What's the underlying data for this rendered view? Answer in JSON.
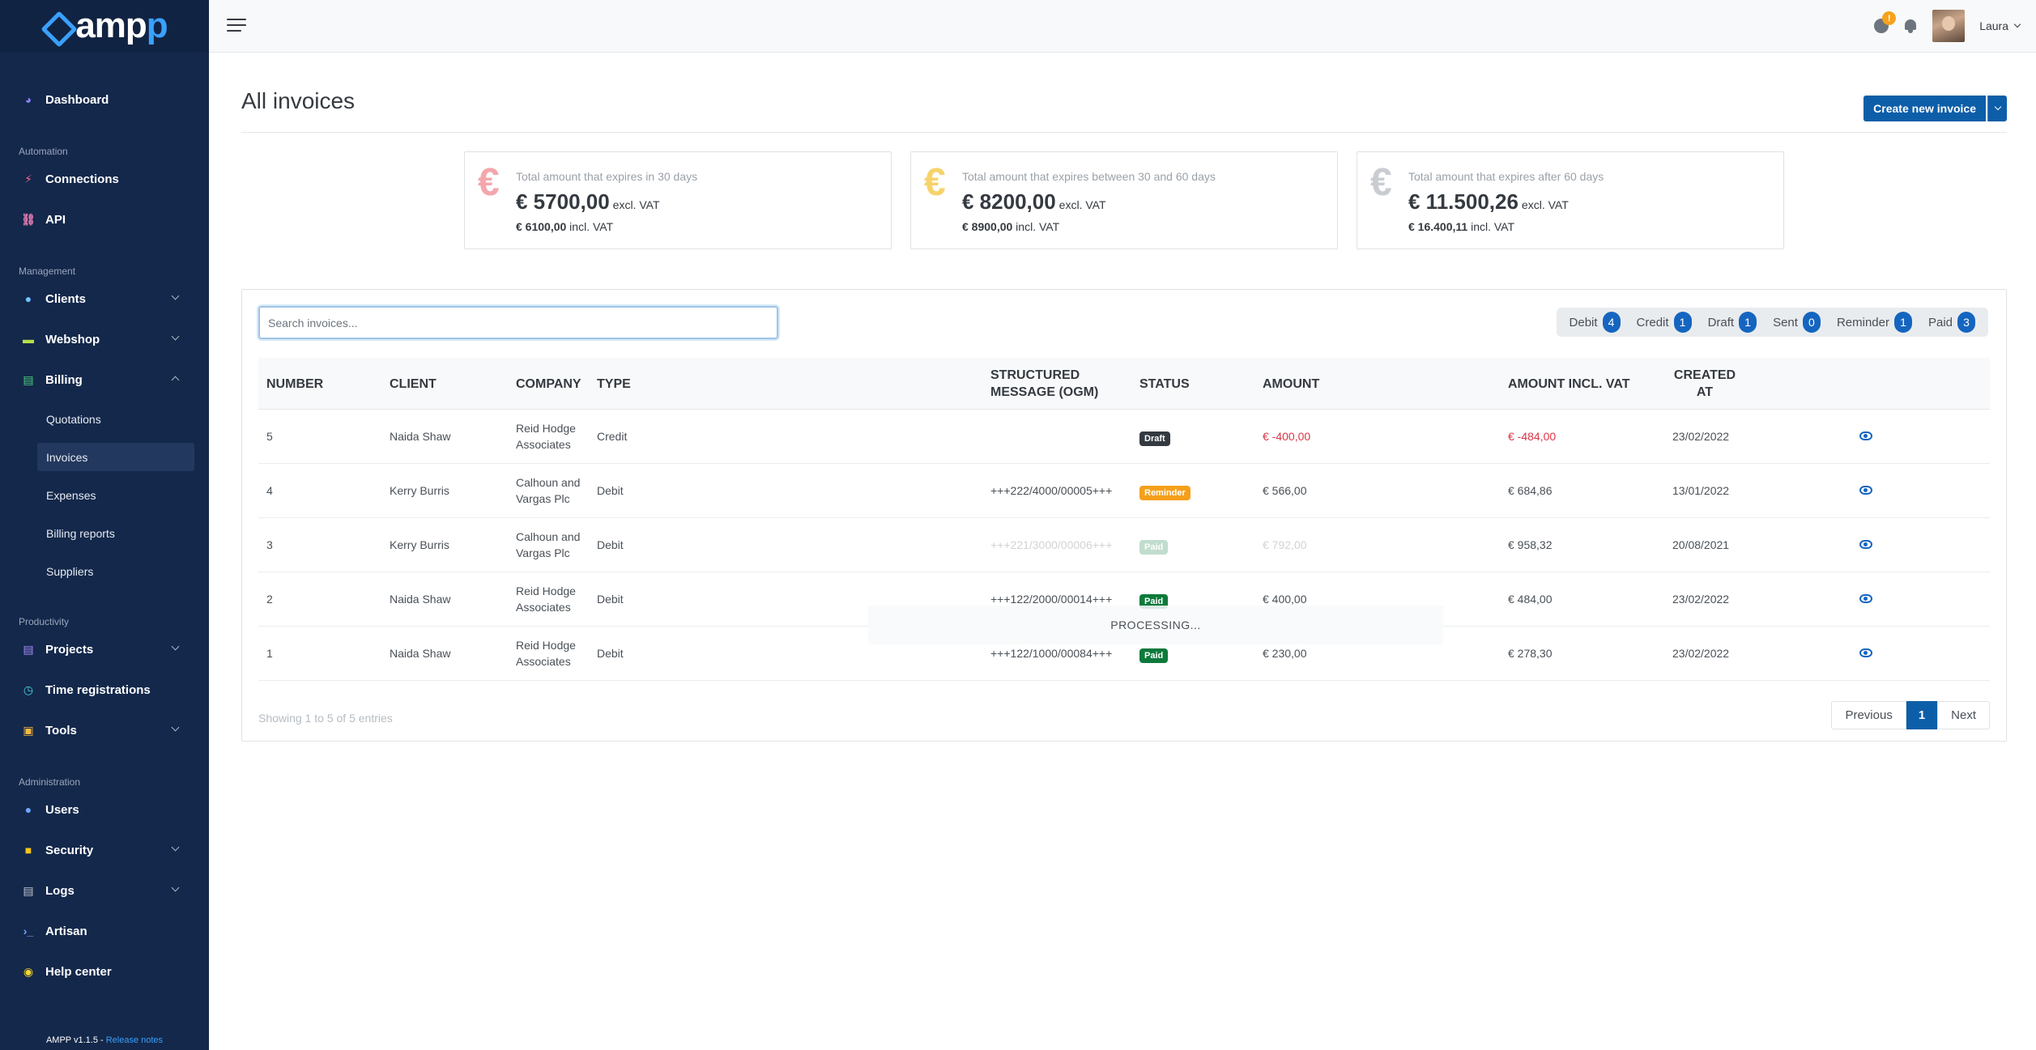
{
  "brand": {
    "name_left": "amp",
    "name_right": "p"
  },
  "sidebar": {
    "items": [
      {
        "label": "Dashboard",
        "icon": "palette-icon",
        "color": "#8b7cf6"
      },
      {
        "section": "Automation"
      },
      {
        "label": "Connections",
        "icon": "plug-icon",
        "color": "#f06a8a"
      },
      {
        "label": "API",
        "icon": "link-icon",
        "color": "#e07ab0"
      },
      {
        "section": "Management"
      },
      {
        "label": "Clients",
        "icon": "users-icon",
        "color": "#6fc3ff"
      },
      {
        "label": "Webshop",
        "icon": "store-icon",
        "color": "#b5e04a"
      },
      {
        "label": "Billing",
        "icon": "invoice-icon",
        "color": "#4cd07d"
      },
      {
        "label": "Quotations"
      },
      {
        "label": "Invoices"
      },
      {
        "label": "Expenses"
      },
      {
        "label": "Billing reports"
      },
      {
        "label": "Suppliers"
      },
      {
        "section": "Productivity"
      },
      {
        "label": "Projects",
        "icon": "clipboard-icon",
        "color": "#a78bfa"
      },
      {
        "label": "Time registrations",
        "icon": "stopwatch-icon",
        "color": "#4fd1e0"
      },
      {
        "label": "Tools",
        "icon": "toolbox-icon",
        "color": "#f5b942"
      },
      {
        "section": "Administration"
      },
      {
        "label": "Users",
        "icon": "group-icon",
        "color": "#6fa8ff"
      },
      {
        "label": "Security",
        "icon": "lock-icon",
        "color": "#f5c518"
      },
      {
        "label": "Logs",
        "icon": "log-icon",
        "color": "#c0c7d1"
      },
      {
        "label": "Artisan",
        "icon": "terminal-icon",
        "color": "#6fa8ff"
      },
      {
        "label": "Help center",
        "icon": "lifebuoy-icon",
        "color": "#f5d630"
      }
    ],
    "version_text": "AMPP v1.1.5 - ",
    "release_notes": "Release notes"
  },
  "topbar": {
    "timer_badge": "!",
    "user_name": "Laura"
  },
  "page": {
    "title": "All invoices",
    "create_button": "Create new invoice"
  },
  "cards": [
    {
      "caption": "Total amount that expires in 30 days",
      "amount": "€ 5700,00",
      "excl": "excl. VAT",
      "incl_amount": "€ 6100,00",
      "incl": " incl. VAT",
      "euro": "€",
      "color": "#f4a6ad"
    },
    {
      "caption": "Total amount that expires between 30 and 60 days",
      "amount": "€ 8200,00",
      "excl": "excl. VAT",
      "incl_amount": "€ 8900,00",
      "incl": " incl. VAT",
      "euro": "€",
      "color": "#f7d36a"
    },
    {
      "caption": "Total amount that expires after 60 days",
      "amount": "€ 11.500,26",
      "excl": "excl. VAT",
      "incl_amount": "€ 16.400,11",
      "incl": " incl. VAT",
      "euro": "€",
      "color": "#c9cdd2"
    }
  ],
  "search": {
    "placeholder": "Search invoices..."
  },
  "filters": [
    {
      "label": "Debit",
      "count": "4"
    },
    {
      "label": "Credit",
      "count": "1"
    },
    {
      "label": "Draft",
      "count": "1"
    },
    {
      "label": "Sent",
      "count": "0"
    },
    {
      "label": "Reminder",
      "count": "1"
    },
    {
      "label": "Paid",
      "count": "3"
    }
  ],
  "table": {
    "headers": {
      "number": "NUMBER",
      "client": "CLIENT",
      "company": "COMPANY",
      "type": "TYPE",
      "ogm_1": "STRUCTURED",
      "ogm_2": "MESSAGE (OGM)",
      "status": "STATUS",
      "amount": "AMOUNT",
      "amount_vat": "AMOUNT INCL. VAT",
      "created_1": "CREATED",
      "created_2": "AT"
    },
    "rows": [
      {
        "number": "5",
        "client": "Naida Shaw",
        "company_1": "Reid Hodge",
        "company_2": "Associates",
        "type": "Credit",
        "ogm": "",
        "status": "Draft",
        "amount": "€ -400,00",
        "amount_vat": "€ -484,00",
        "created": "23/02/2022"
      },
      {
        "number": "4",
        "client": "Kerry Burris",
        "company_1": "Calhoun and",
        "company_2": "Vargas Plc",
        "type": "Debit",
        "ogm": "+++222/4000/00005+++",
        "status": "Reminder",
        "amount": "€ 566,00",
        "amount_vat": "€ 684,86",
        "created": "13/01/2022"
      },
      {
        "number": "3",
        "client": "Kerry Burris",
        "company_1": "Calhoun and",
        "company_2": "Vargas Plc",
        "type": "Debit",
        "ogm": "+++221/3000/00006+++",
        "status": "Paid",
        "amount": "€ 792,00",
        "amount_vat": "€ 958,32",
        "created": "20/08/2021"
      },
      {
        "number": "2",
        "client": "Naida Shaw",
        "company_1": "Reid Hodge",
        "company_2": "Associates",
        "type": "Debit",
        "ogm": "+++122/2000/00014+++",
        "status": "Paid",
        "amount": "€ 400,00",
        "amount_vat": "€ 484,00",
        "created": "23/02/2022"
      },
      {
        "number": "1",
        "client": "Naida Shaw",
        "company_1": "Reid Hodge",
        "company_2": "Associates",
        "type": "Debit",
        "ogm": "+++122/1000/00084+++",
        "status": "Paid",
        "amount": "€ 230,00",
        "amount_vat": "€ 278,30",
        "created": "23/02/2022"
      }
    ],
    "processing": "PROCESSING..."
  },
  "footer": {
    "showing": "Showing 1 to 5 of 5 entries",
    "prev": "Previous",
    "page": "1",
    "next": "Next"
  }
}
